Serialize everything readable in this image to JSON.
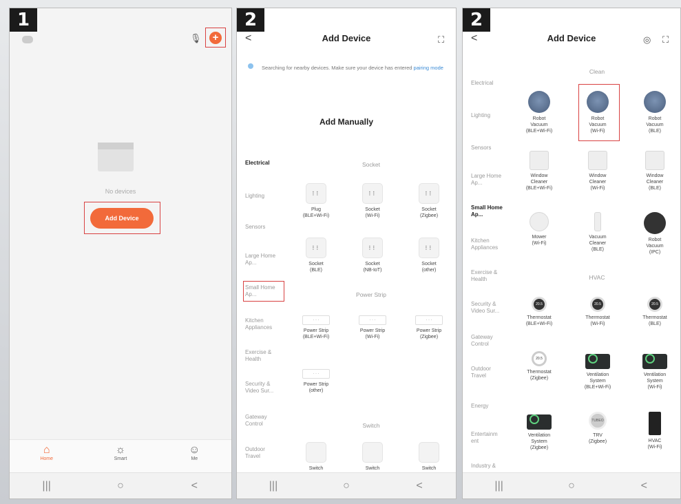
{
  "steps": [
    "1",
    "2",
    "2"
  ],
  "phone1": {
    "empty_text": "No devices",
    "add_button": "Add Device",
    "tabs": [
      {
        "icon": "home-icon",
        "label": "Home"
      },
      {
        "icon": "smart-icon",
        "label": "Smart"
      },
      {
        "icon": "me-icon",
        "label": "Me"
      }
    ]
  },
  "phone2": {
    "title": "Add Device",
    "search_text": "Searching for nearby devices. Make sure your device has entered",
    "search_link": "pairing mode",
    "add_manually": "Add Manually",
    "categories": [
      "Electrical",
      "Lighting",
      "Sensors",
      "Large Home Ap...",
      "Small Home Ap...",
      "Kitchen Appliances",
      "Exercise & Health",
      "Security & Video Sur...",
      "Gateway Control",
      "Outdoor Travel"
    ],
    "sections": [
      "Socket",
      "Power Strip",
      "Switch"
    ],
    "socket_devices": [
      [
        "Plug",
        "(BLE+Wi-Fi)"
      ],
      [
        "Socket",
        "(Wi-Fi)"
      ],
      [
        "Socket",
        "(Zigbee)"
      ],
      [
        "Socket",
        "(BLE)"
      ],
      [
        "Socket",
        "(NB-IoT)"
      ],
      [
        "Socket",
        "(other)"
      ]
    ],
    "strip_devices": [
      [
        "Power Strip",
        "(BLE+Wi-Fi)"
      ],
      [
        "Power Strip",
        "(Wi-Fi)"
      ],
      [
        "Power Strip",
        "(Zigbee)"
      ],
      [
        "Power Strip",
        "(other)"
      ]
    ],
    "switch_devices": [
      "Switch",
      "Switch",
      "Switch"
    ]
  },
  "phone3": {
    "title": "Add Device",
    "categories": [
      "Electrical",
      "Lighting",
      "Sensors",
      "Large Home Ap...",
      "Small Home Ap...",
      "Kitchen Appliances",
      "Exercise & Health",
      "Security & Video Sur...",
      "Gateway Control",
      "Outdoor Travel",
      "Energy",
      "Entertainm ent",
      "Industry &"
    ],
    "sections": [
      "Clean",
      "HVAC"
    ],
    "clean_devices": [
      [
        "Robot",
        "Vacuum",
        "(BLE+Wi-Fi)"
      ],
      [
        "Robot",
        "Vacuum",
        "(Wi-Fi)"
      ],
      [
        "Robot",
        "Vacuum",
        "(BLE)"
      ],
      [
        "Window",
        "Cleaner",
        "(BLE+Wi-Fi)"
      ],
      [
        "Window",
        "Cleaner",
        "(Wi-Fi)"
      ],
      [
        "Window",
        "Cleaner",
        "(BLE)"
      ],
      [
        "Mower",
        "(Wi-Fi)",
        ""
      ],
      [
        "Vacuum",
        "Cleaner",
        "(BLE)"
      ],
      [
        "Robot",
        "Vacuum",
        "(IPC)"
      ]
    ],
    "hvac_devices": [
      [
        "Thermostat",
        "(BLE+Wi-Fi)",
        ""
      ],
      [
        "Thermostat",
        "(Wi-Fi)",
        ""
      ],
      [
        "Thermostat",
        "(BLE)",
        ""
      ],
      [
        "Thermostat",
        "(Zigbee)",
        ""
      ],
      [
        "Ventilation",
        "System",
        "(BLE+Wi-Fi)"
      ],
      [
        "Ventilation",
        "System",
        "(Wi-Fi)"
      ],
      [
        "Ventilation",
        "System",
        "(Zigbee)"
      ],
      [
        "TRV",
        "(Zigbee)",
        ""
      ],
      [
        "HVAC",
        "(Wi-Fi)",
        ""
      ]
    ],
    "thermo_label": "20.5",
    "trv_label": "TUBEO"
  },
  "system_nav": [
    "|||",
    "○",
    "<"
  ],
  "colors": {
    "accent": "#f26a3a",
    "highlight": "#d84040",
    "link": "#3a8bd6"
  }
}
